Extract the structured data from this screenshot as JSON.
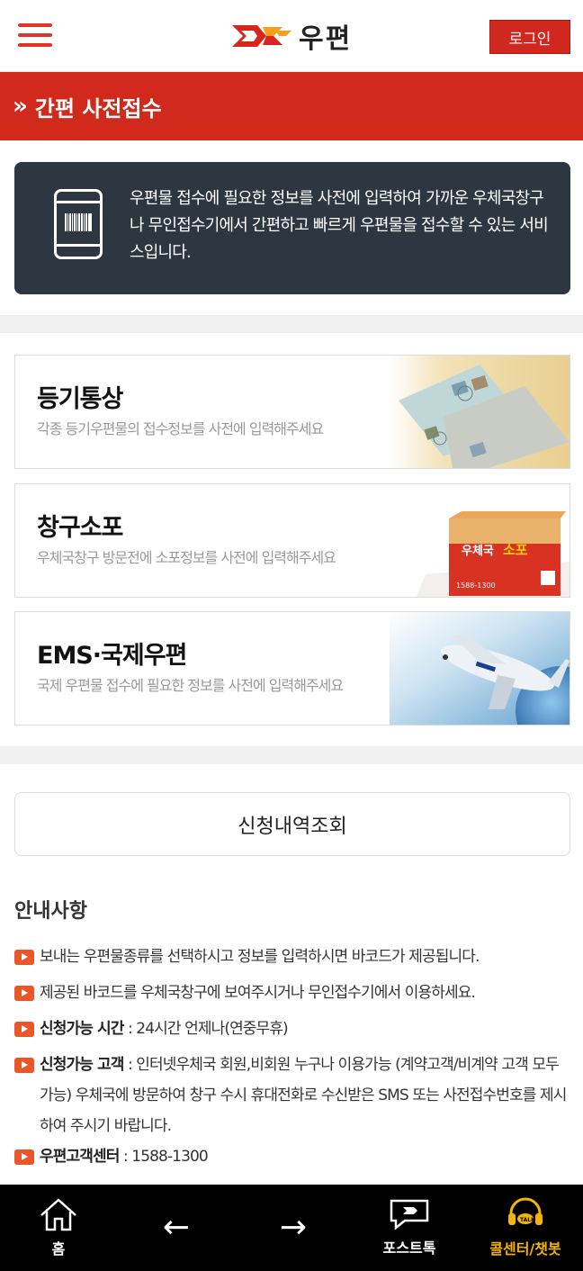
{
  "header": {
    "logo_text": "우편",
    "login_label": "로그인"
  },
  "titlebar": {
    "chevron": "»",
    "title": "간편 사전접수"
  },
  "intro": {
    "description": "우편물 접수에 필요한 정보를 사전에 입력하여 가까운 우체국창구나 무인접수기에서 간편하고 빠르게 우편물을 접수할 수 있는 서비스입니다."
  },
  "services": [
    {
      "title": "등기통상",
      "subtitle": "각종 등기우편물의 접수정보를 사전에 입력해주세요"
    },
    {
      "title": "창구소포",
      "subtitle": "우체국창구 방문전에 소포정보를 사전에 입력해주세요"
    },
    {
      "title": "EMS·국제우편",
      "subtitle": "국제 우편물 접수에 필요한 정보를 사전에 입력해주세요"
    }
  ],
  "parcel_box": {
    "brand": "우체국",
    "label": "소포",
    "phone": "1588-1300"
  },
  "lookup_label": "신청내역조회",
  "notice": {
    "title": "안내사항",
    "items": [
      {
        "bold": "",
        "text": "보내는 우편물종류를 선택하시고 정보를 입력하시면 바코드가 제공됩니다."
      },
      {
        "bold": "",
        "text": "제공된 바코드를 우체국창구에 보여주시거나 무인접수기에서 이용하세요."
      },
      {
        "bold": "신청가능 시간",
        "text": " : 24시간 언제나(연중무휴)"
      },
      {
        "bold": "신청가능 고객",
        "text": " : 인터넷우체국 회원,비회원 누구나 이용가능 (계약고객/비계약 고객 모두 가능) 우체국에 방문하여 창구 수시 휴대전화로 수신받은 SMS 또는 사전접수번호를 제시하여 주시기 바랍니다."
      },
      {
        "bold": "우편고객센터",
        "text": " : 1588-1300"
      }
    ]
  },
  "bottom_nav": {
    "home": "홈",
    "back": "←",
    "forward": "→",
    "posttalk": "포스트톡",
    "callcenter": "콜센터/챗봇",
    "callcenter_color": "#f5b400"
  },
  "colors": {
    "brand_red": "#d2291d",
    "info_bg": "#2c3741",
    "bullet_orange": "#e8562a"
  }
}
